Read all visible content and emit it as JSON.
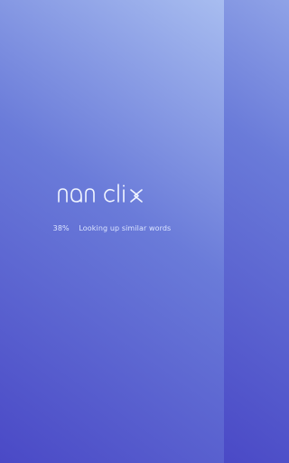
{
  "app": {
    "logo_text": "nan clix"
  },
  "loading": {
    "percent": "38%",
    "percent_value": 0.38,
    "message": "Looking up similar words"
  },
  "colors": {
    "gradient_start": "#4a49c6",
    "gradient_mid": "#6a7bd9",
    "gradient_end": "#a8bdf0",
    "logo_stroke": "#f2f6ff",
    "status_text": "#dce5ff"
  },
  "icons": {
    "logo": "nan-clix-wordmark"
  }
}
